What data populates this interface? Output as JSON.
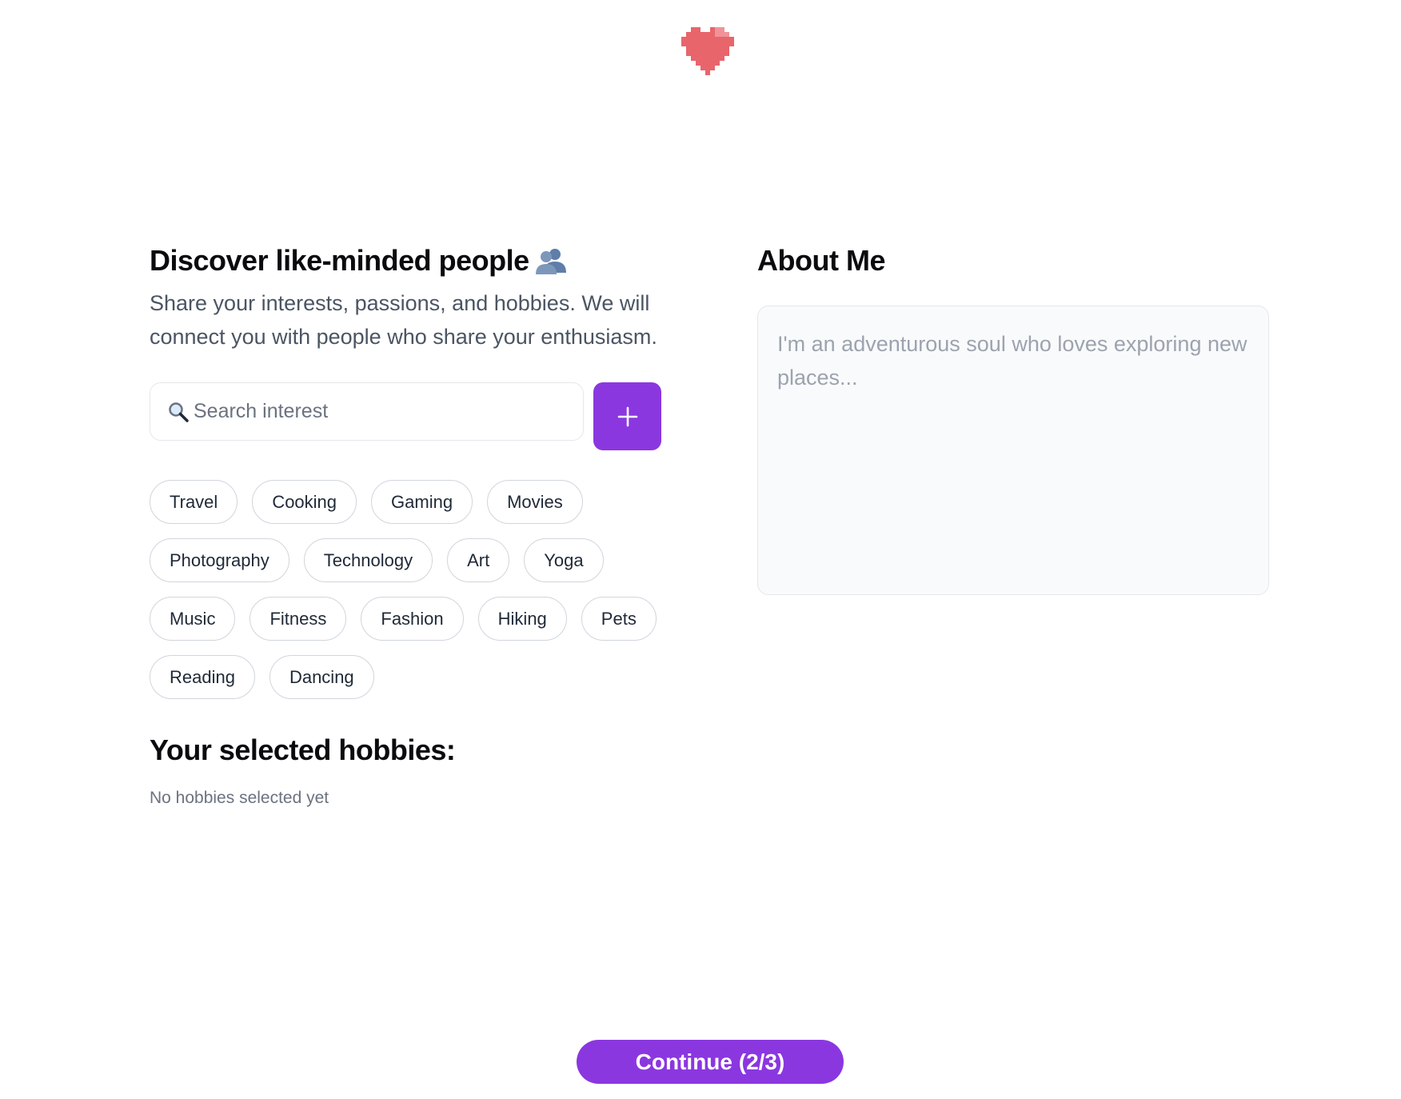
{
  "colors": {
    "accent": "#8b37e0",
    "heart": "#e8656b",
    "text_primary": "#0b0b0f",
    "text_secondary": "#4b5563",
    "border": "#e5e7eb"
  },
  "header": {
    "logo_icon": "pixel-heart-icon"
  },
  "discover": {
    "title": "Discover like-minded people",
    "title_icon": "people-silhouette-icon",
    "description": "Share your interests, passions, and hobbies. We will connect you with people who share your enthusiasm.",
    "search": {
      "icon": "magnifier-icon",
      "placeholder": "Search interest",
      "value": ""
    },
    "add_button_icon": "plus-icon",
    "interests": [
      "Travel",
      "Cooking",
      "Gaming",
      "Movies",
      "Photography",
      "Technology",
      "Art",
      "Yoga",
      "Music",
      "Fitness",
      "Fashion",
      "Hiking",
      "Pets",
      "Reading",
      "Dancing"
    ],
    "selected_title": "Your selected hobbies:",
    "selected_empty": "No hobbies selected yet"
  },
  "about": {
    "title": "About Me",
    "placeholder": "I'm an adventurous soul who loves exploring new places...",
    "value": ""
  },
  "footer": {
    "continue_label": "Continue (2/3)"
  }
}
